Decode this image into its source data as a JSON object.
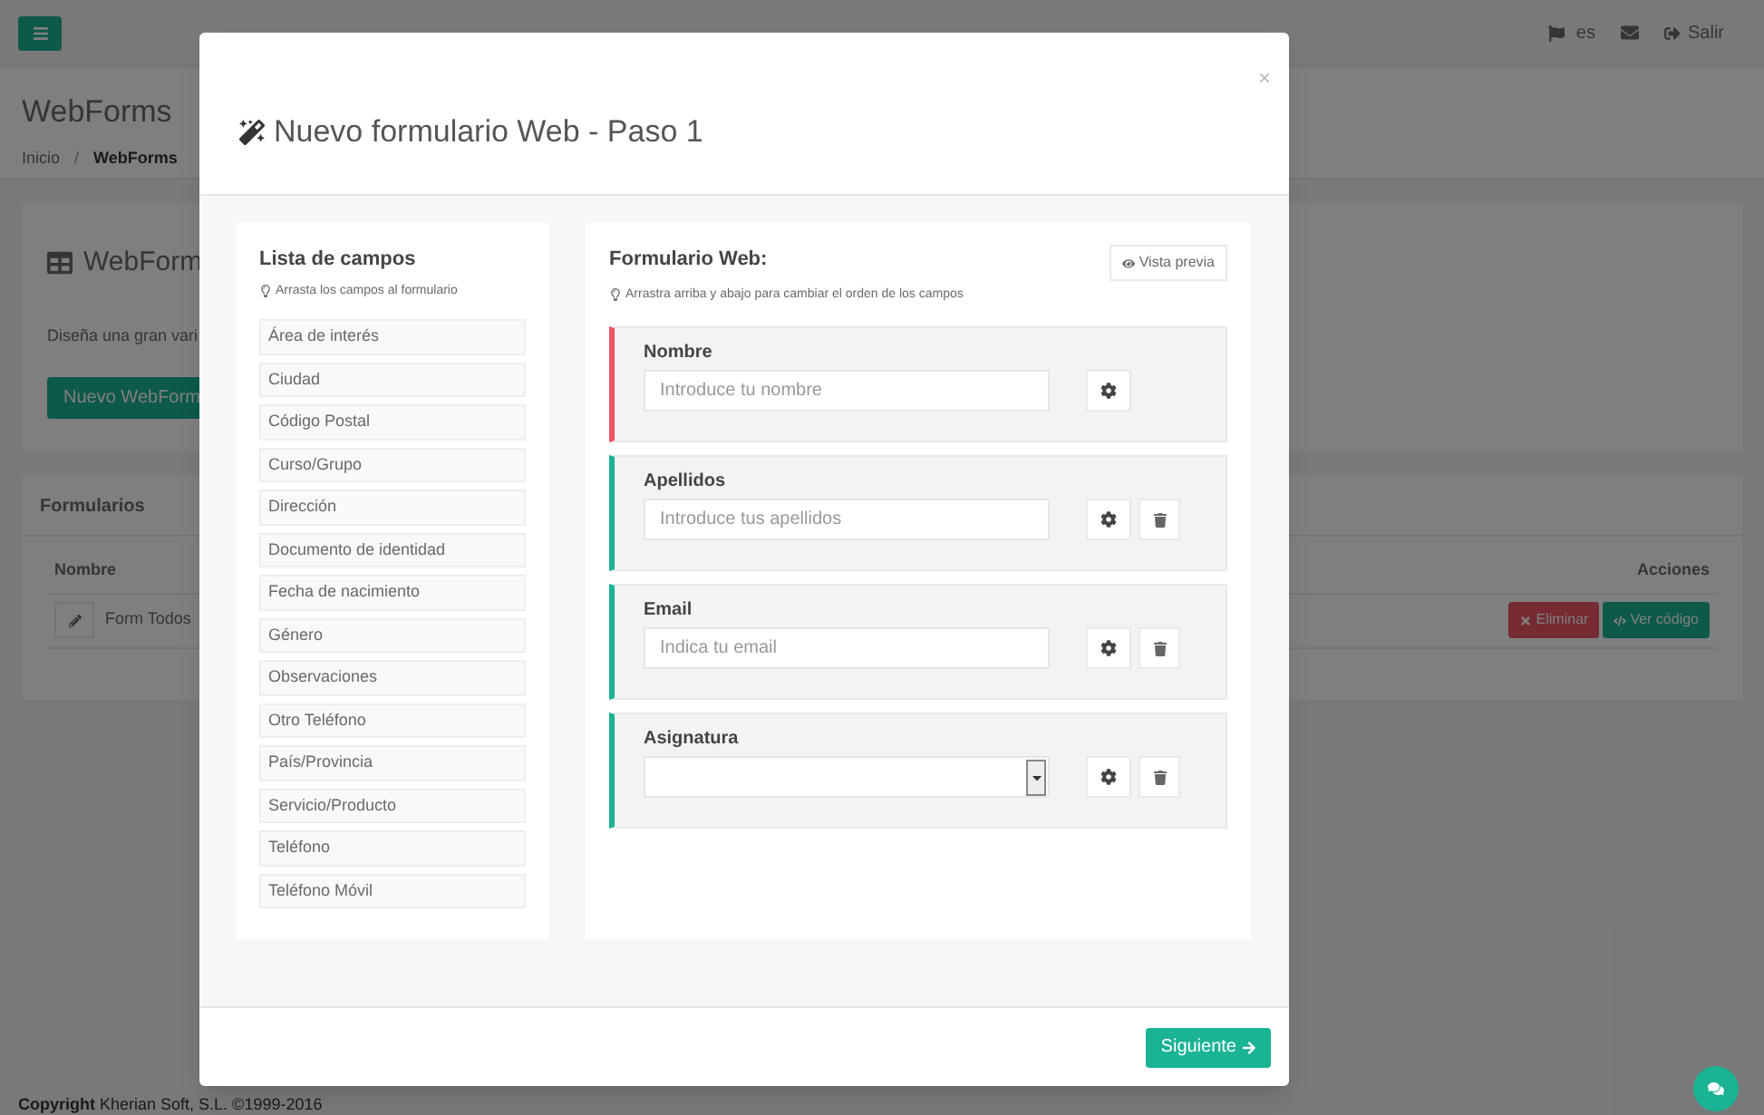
{
  "topbar": {
    "language": "es",
    "logout": "Salir"
  },
  "page": {
    "title": "WebForms",
    "breadcrumb": [
      {
        "label": "Inicio",
        "current": false
      },
      {
        "label": "WebForms",
        "current": true
      }
    ],
    "separator": "/"
  },
  "intro_card": {
    "title": "WebForm",
    "description": "Diseña una gran vari",
    "button": "Nuevo WebForm"
  },
  "forms_card": {
    "title": "Formularios",
    "columns": [
      "Nombre",
      "Acciones"
    ],
    "rows": [
      {
        "name": "Form Todos",
        "actions": [
          "Eliminar",
          "Ver código"
        ]
      }
    ]
  },
  "footer": {
    "owner": "Copyright",
    "text": "Kherian Soft, S.L. ©1999-2016"
  },
  "modal": {
    "title": "Nuevo formulario Web - Paso 1",
    "close": "×",
    "fields_panel": {
      "title": "Lista de campos",
      "hint": "Arrasta los campos al formulario",
      "items": [
        "Área de interés",
        "Ciudad",
        "Código Postal",
        "Curso/Grupo",
        "Dirección",
        "Documento de identidad",
        "Fecha de nacimiento",
        "Género",
        "Observaciones",
        "Otro Teléfono",
        "País/Provincia",
        "Servicio/Producto",
        "Teléfono",
        "Teléfono Móvil"
      ]
    },
    "form_panel": {
      "title": "Formulario Web:",
      "hint": "Arrastra arriba y abajo para cambiar el orden de los campos",
      "preview_button": "Vista previa",
      "fields": [
        {
          "label": "Nombre",
          "kind": "text",
          "placeholder": "Introduce tu nombre",
          "color": "#ed5565",
          "deletable": false
        },
        {
          "label": "Apellidos",
          "kind": "text",
          "placeholder": "Introduce tus apellidos",
          "color": "#1ab394",
          "deletable": true
        },
        {
          "label": "Email",
          "kind": "text",
          "placeholder": "Indica tu email",
          "color": "#1ab394",
          "deletable": true
        },
        {
          "label": "Asignatura",
          "kind": "select",
          "color": "#1ab394",
          "deletable": true
        }
      ]
    },
    "next_button": "Siguiente"
  }
}
